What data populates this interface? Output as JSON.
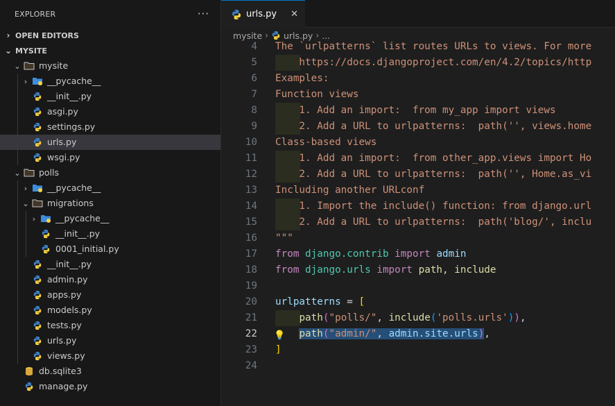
{
  "explorer": {
    "title": "EXPLORER",
    "more_label": "···",
    "open_editors": "OPEN EDITORS",
    "project": "MYSITE"
  },
  "tree": [
    {
      "label": "mysite",
      "kind": "folder",
      "level": 1,
      "open": true
    },
    {
      "label": "__pycache__",
      "kind": "pyfolder",
      "level": 2,
      "open": false
    },
    {
      "label": "__init__.py",
      "kind": "py",
      "level": 2
    },
    {
      "label": "asgi.py",
      "kind": "py",
      "level": 2
    },
    {
      "label": "settings.py",
      "kind": "py",
      "level": 2
    },
    {
      "label": "urls.py",
      "kind": "py",
      "level": 2,
      "selected": true
    },
    {
      "label": "wsgi.py",
      "kind": "py",
      "level": 2
    },
    {
      "label": "polls",
      "kind": "folder",
      "level": 1,
      "open": true
    },
    {
      "label": "__pycache__",
      "kind": "pyfolder",
      "level": 2,
      "open": false
    },
    {
      "label": "migrations",
      "kind": "folder",
      "level": 2,
      "open": true
    },
    {
      "label": "__pycache__",
      "kind": "pyfolder",
      "level": 3,
      "open": false
    },
    {
      "label": "__init__.py",
      "kind": "py",
      "level": 3
    },
    {
      "label": "0001_initial.py",
      "kind": "py",
      "level": 3
    },
    {
      "label": "__init__.py",
      "kind": "py",
      "level": 2
    },
    {
      "label": "admin.py",
      "kind": "py",
      "level": 2
    },
    {
      "label": "apps.py",
      "kind": "py",
      "level": 2
    },
    {
      "label": "models.py",
      "kind": "py",
      "level": 2
    },
    {
      "label": "tests.py",
      "kind": "py",
      "level": 2
    },
    {
      "label": "urls.py",
      "kind": "py",
      "level": 2
    },
    {
      "label": "views.py",
      "kind": "py",
      "level": 2
    },
    {
      "label": "db.sqlite3",
      "kind": "db",
      "level": 1
    },
    {
      "label": "manage.py",
      "kind": "py",
      "level": 1
    }
  ],
  "tab": {
    "label": "urls.py",
    "close": "✕"
  },
  "breadcrumb": {
    "folder": "mysite",
    "file": "urls.py",
    "more": "..."
  },
  "colors": {
    "accent": "#0078d4",
    "selection": "#264f78",
    "sidebar_selected": "#37373d"
  },
  "code": [
    {
      "n": "4",
      "tokens": [
        [
          "doc",
          "The `urlpatterns` list routes URLs to views. For more"
        ]
      ]
    },
    {
      "n": "5",
      "guide": true,
      "tokens": [
        [
          "doc",
          "    https://docs.djangoproject.com/en/4.2/topics/http"
        ]
      ]
    },
    {
      "n": "6",
      "tokens": [
        [
          "doc",
          "Examples:"
        ]
      ]
    },
    {
      "n": "7",
      "tokens": [
        [
          "doc",
          "Function views"
        ]
      ]
    },
    {
      "n": "8",
      "guide": true,
      "tokens": [
        [
          "doc",
          "    1. Add an import:  from my_app import views"
        ]
      ]
    },
    {
      "n": "9",
      "guide": true,
      "tokens": [
        [
          "doc",
          "    2. Add a URL to urlpatterns:  path('', views.home"
        ]
      ]
    },
    {
      "n": "10",
      "tokens": [
        [
          "doc",
          "Class-based views"
        ]
      ]
    },
    {
      "n": "11",
      "guide": true,
      "tokens": [
        [
          "doc",
          "    1. Add an import:  from other_app.views import Ho"
        ]
      ]
    },
    {
      "n": "12",
      "guide": true,
      "tokens": [
        [
          "doc",
          "    2. Add a URL to urlpatterns:  path('', Home.as_vi"
        ]
      ]
    },
    {
      "n": "13",
      "tokens": [
        [
          "doc",
          "Including another URLconf"
        ]
      ]
    },
    {
      "n": "14",
      "guide": true,
      "tokens": [
        [
          "doc",
          "    1. Import the include() function: from django.url"
        ]
      ]
    },
    {
      "n": "15",
      "guide": true,
      "tokens": [
        [
          "doc",
          "    2. Add a URL to urlpatterns:  path('blog/', inclu"
        ]
      ]
    },
    {
      "n": "16",
      "tokens": [
        [
          "doc",
          "\"\"\""
        ]
      ]
    },
    {
      "n": "17",
      "tokens": [
        [
          "kw",
          "from "
        ],
        [
          "mod",
          "django.contrib"
        ],
        [
          "kw",
          " import "
        ],
        [
          "var",
          "admin"
        ]
      ]
    },
    {
      "n": "18",
      "tokens": [
        [
          "kw",
          "from "
        ],
        [
          "mod",
          "django.urls"
        ],
        [
          "kw",
          " import "
        ],
        [
          "fn",
          "path"
        ],
        [
          "pun",
          ", "
        ],
        [
          "fn",
          "include"
        ]
      ]
    },
    {
      "n": "19",
      "tokens": []
    },
    {
      "n": "20",
      "tokens": [
        [
          "var",
          "urlpatterns"
        ],
        [
          "pun",
          " = "
        ],
        [
          "br1",
          "["
        ]
      ]
    },
    {
      "n": "21",
      "guide": true,
      "tokens": [
        [
          "pun",
          "    "
        ],
        [
          "fn",
          "path"
        ],
        [
          "br2",
          "("
        ],
        [
          "str",
          "\"polls/\""
        ],
        [
          "pun",
          ", "
        ],
        [
          "fn",
          "include"
        ],
        [
          "br3",
          "("
        ],
        [
          "str",
          "'polls.urls'"
        ],
        [
          "br3",
          ")"
        ],
        [
          "br2",
          ")"
        ],
        [
          "pun",
          ","
        ]
      ]
    },
    {
      "n": "22",
      "active": true,
      "bulb": "💡",
      "tokens": [
        [
          "pun",
          "    "
        ],
        [
          "fn sel",
          "path"
        ],
        [
          "br2 sel",
          "("
        ],
        [
          "str sel",
          "\"admin/\""
        ],
        [
          "pun sel",
          ", "
        ],
        [
          "var sel",
          "admin"
        ],
        [
          "pun sel",
          "."
        ],
        [
          "var sel",
          "site"
        ],
        [
          "pun sel",
          "."
        ],
        [
          "var sel",
          "urls"
        ],
        [
          "br2 sel",
          ")"
        ],
        [
          "pun",
          ","
        ]
      ]
    },
    {
      "n": "23",
      "tokens": [
        [
          "br1",
          "]"
        ]
      ]
    },
    {
      "n": "24",
      "tokens": []
    }
  ]
}
